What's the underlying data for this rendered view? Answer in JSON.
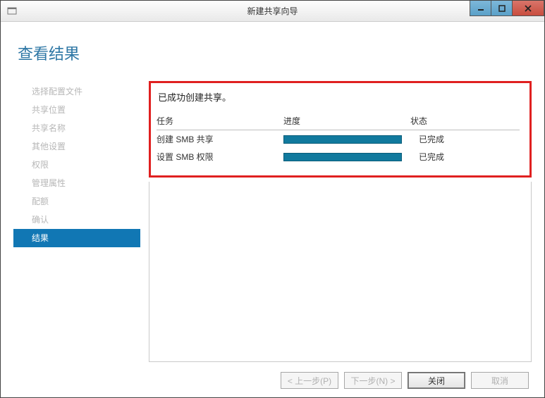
{
  "window": {
    "title": "新建共享向导"
  },
  "heading": "查看结果",
  "sidebar": {
    "items": [
      {
        "label": "选择配置文件"
      },
      {
        "label": "共享位置"
      },
      {
        "label": "共享名称"
      },
      {
        "label": "其他设置"
      },
      {
        "label": "权限"
      },
      {
        "label": "管理属性"
      },
      {
        "label": "配额"
      },
      {
        "label": "确认"
      },
      {
        "label": "结果"
      }
    ],
    "active_index": 8
  },
  "result": {
    "message": "已成功创建共享。",
    "columns": {
      "task": "任务",
      "progress": "进度",
      "status": "状态"
    },
    "rows": [
      {
        "task": "创建 SMB 共享",
        "status": "已完成"
      },
      {
        "task": "设置 SMB 权限",
        "status": "已完成"
      }
    ]
  },
  "buttons": {
    "prev": "< 上一步(P)",
    "next": "下一步(N) >",
    "close": "关闭",
    "cancel": "取消"
  }
}
